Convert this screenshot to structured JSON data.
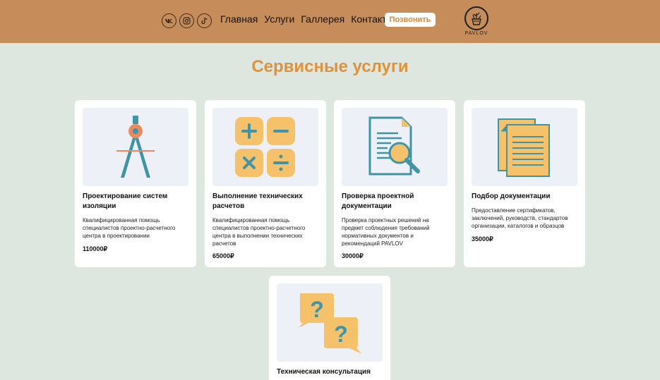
{
  "header": {
    "nav": [
      "Главная",
      "Услуги",
      "Галлерея",
      "Контакты"
    ],
    "call_label": "Позвонить",
    "logo_text": "PAVLOV",
    "socials": [
      "vk-icon",
      "instagram-icon",
      "tiktok-icon"
    ],
    "bg_color": "#c68d5a"
  },
  "page_title": "Сервисные услуги",
  "cards": [
    {
      "title": "Проектирование систем изоляции",
      "desc": "Квалифицированная помощь специалистов проектно-расчетного центра в проектировании",
      "price": "110000₽",
      "icon": "compass-icon"
    },
    {
      "title": "Выполнение технических расчетов",
      "desc": "Квалифицированная помощь специалистов проектно-расчетного центра в выполнении технических расчетов",
      "price": "65000₽",
      "icon": "calculator-icon"
    },
    {
      "title": "Проверка проектной документации",
      "desc": "Проверка проектных решений на предмет соблюдения требований нормативных документов и рекомендаций PAVLOV",
      "price": "30000₽",
      "icon": "document-search-icon"
    },
    {
      "title": "Подбор документации",
      "desc": "Предоставление сертификатов, заключений, руководств, стандартов организации, каталогов и образцов",
      "price": "35000₽",
      "icon": "documents-icon"
    },
    {
      "title": "Техническая консультация",
      "desc": "",
      "price": "",
      "icon": "question-bubbles-icon"
    }
  ],
  "colors": {
    "accent": "#e0913a",
    "bg": "#dde7df",
    "teal": "#3f94a8",
    "yellow": "#f5c26b",
    "orange": "#e98b5e"
  }
}
